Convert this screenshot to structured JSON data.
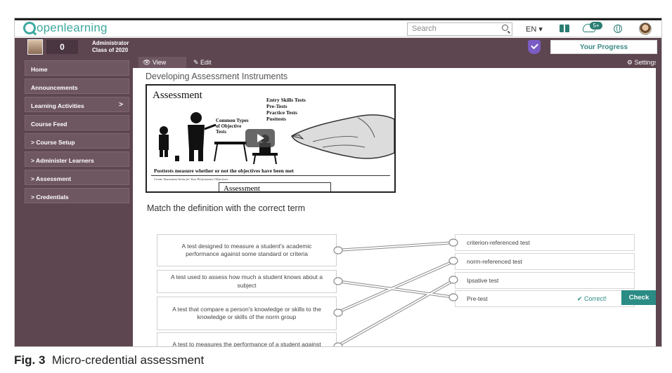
{
  "app": {
    "logo": "openlearning",
    "search_placeholder": "Search",
    "language": "EN ▾",
    "notification_count": "5+"
  },
  "user": {
    "points": "0",
    "name": "Administrator",
    "class": "Class of 2020",
    "progress_label": "Your Progress"
  },
  "sidebar": {
    "items": [
      {
        "label": "Home"
      },
      {
        "label": "Announcements"
      },
      {
        "label": "Learning Activities",
        "arrow": ">"
      },
      {
        "label": "Course Feed"
      },
      {
        "label": "> Course Setup"
      },
      {
        "label": "> Administer Learners"
      },
      {
        "label": "> Assessment"
      },
      {
        "label": "> Credentials"
      }
    ]
  },
  "tabs": {
    "view": "👁 View",
    "edit": "✎ Edit",
    "settings": "⚙ Settings"
  },
  "page": {
    "title": "Developing Assessment Instruments"
  },
  "video": {
    "title": "Assessment",
    "list": [
      "Entry Skills Tests",
      "Pre-Tests",
      "Practice Tests",
      "Posttests"
    ],
    "common_types": [
      "Common Types",
      "of Objective",
      "Tests"
    ],
    "caption": "Posttests measure whether or not the objectives have been met",
    "small": "Create Assessment Items for Your Performance Objectives",
    "next_slide": "Assessment"
  },
  "matching": {
    "title": "Match the definition with the correct term",
    "definitions": [
      "A test designed to measure a student's academic performance against some standard or criteria",
      "A test used to assess how much a student knows about a subject",
      "A test that compare a person's knowledge or skills to the knowledge or skills of the norm group",
      "A test to measures the performance of a student against previous performances from that student"
    ],
    "terms": [
      "criterion-referenced test",
      "norm-referenced test",
      "Ipsative test",
      "Pre-test"
    ],
    "result": "✔ Correct!",
    "check_label": "Check"
  },
  "figure": {
    "label": "Fig. 3",
    "caption": "Micro-credential assessment"
  },
  "colors": {
    "teal": "#2a8c85",
    "plum": "#5d4650",
    "logo": "#3fa99f"
  }
}
